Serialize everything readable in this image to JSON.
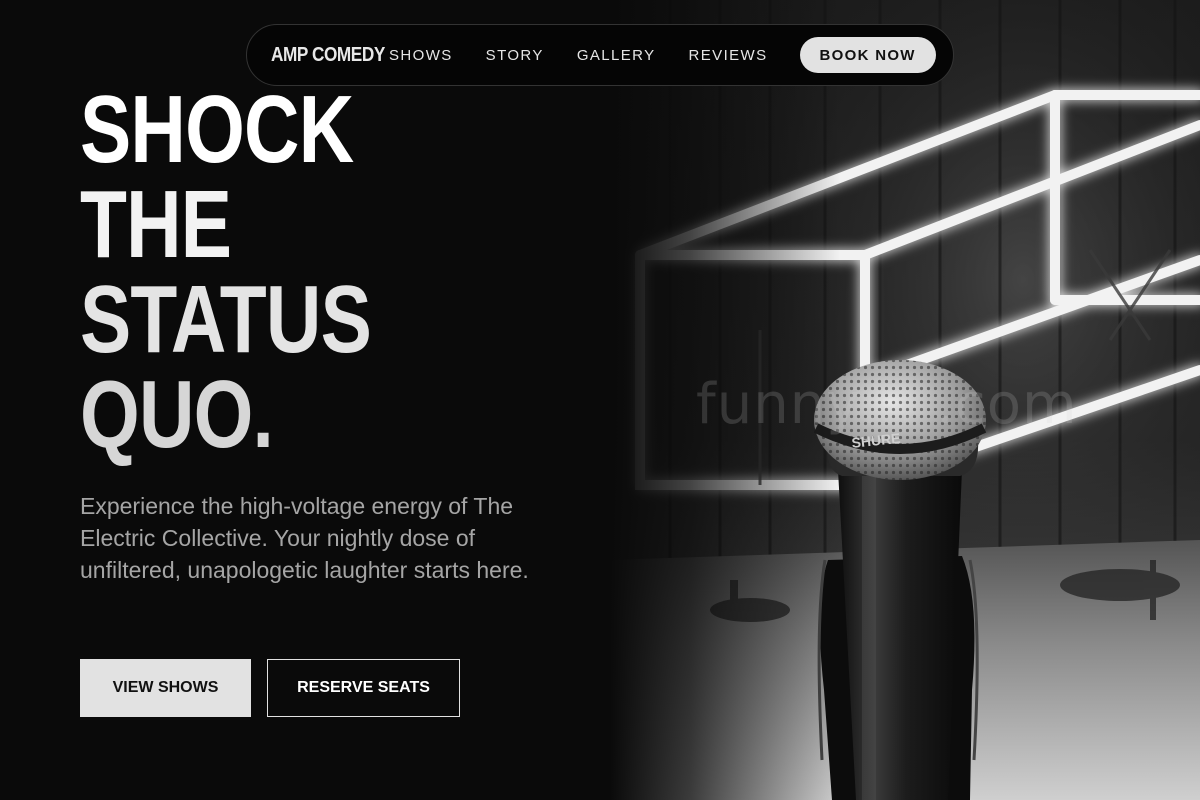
{
  "nav": {
    "brand": "AMP COMEDY",
    "links": [
      "SHOWS",
      "STORY",
      "GALLERY",
      "REVIEWS"
    ],
    "cta": "BOOK NOW"
  },
  "hero": {
    "headline": [
      "SHOCK",
      "THE",
      "STATUS",
      "QUO."
    ],
    "tagline": "Experience the high-voltage energy of The Electric Collective. Your nightly dose of unfiltered, unapologetic laughter starts here.",
    "primary_button": "VIEW SHOWS",
    "secondary_button": "RESERVE SEATS",
    "watermark": "funny… .com",
    "image": "microphone-on-stage-neon"
  },
  "colors": {
    "background": "#0a0a0a",
    "accent_button": "#e2e2e2",
    "tagline": "#a5a5a5"
  }
}
